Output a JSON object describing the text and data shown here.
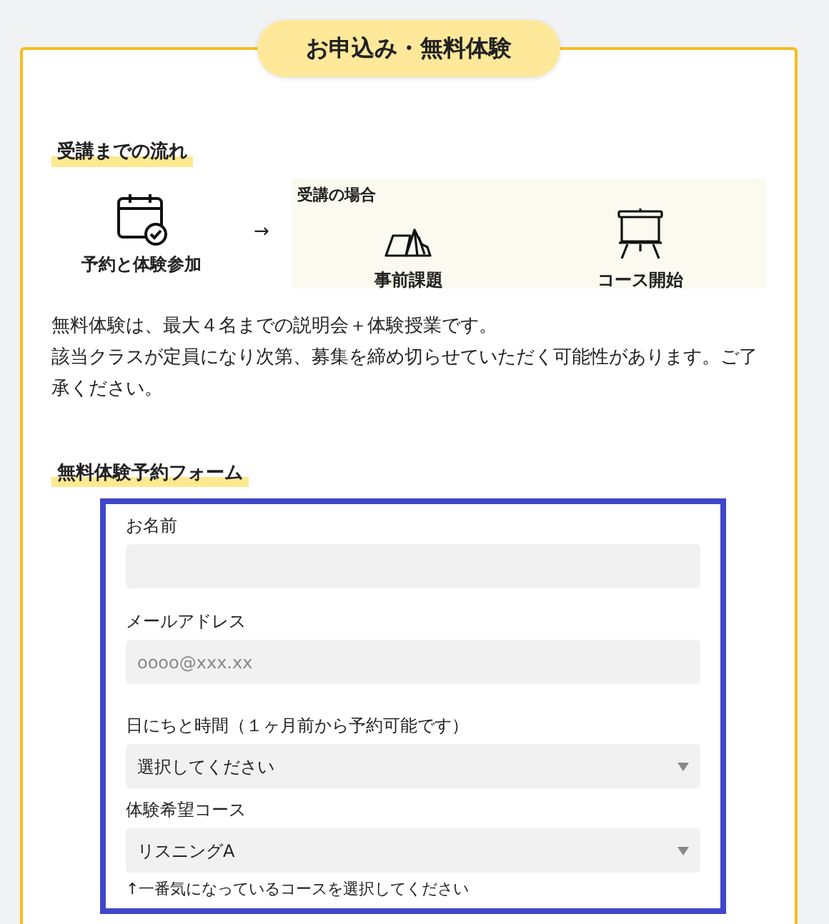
{
  "title": "お申込み・無料体験",
  "flow": {
    "heading": "受講までの流れ",
    "first_step": {
      "label": "予約と体験参加"
    },
    "arrow": "→",
    "course_group": {
      "title": "受講の場合",
      "steps": [
        {
          "label": "事前課題"
        },
        {
          "label": "コース開始"
        }
      ]
    }
  },
  "notice": [
    "無料体験は、最大４名までの説明会＋体験授業です。",
    "該当クラスが定員になり次第、募集を締め切らせていただく可能性があります。ご了承ください。"
  ],
  "form": {
    "heading": "無料体験予約フォーム",
    "fields": [
      {
        "kind": "text",
        "label": "お名前"
      },
      {
        "kind": "text",
        "label": "メールアドレス",
        "placeholder": "oooo@xxx.xx"
      },
      {
        "kind": "select",
        "label": "日にちと時間（１ヶ月前から予約可能です）",
        "value": "選択してください"
      },
      {
        "kind": "select",
        "label": "体験希望コース",
        "value": "リスニングA",
        "note": "↑一番気になっているコースを選択してください"
      }
    ]
  }
}
